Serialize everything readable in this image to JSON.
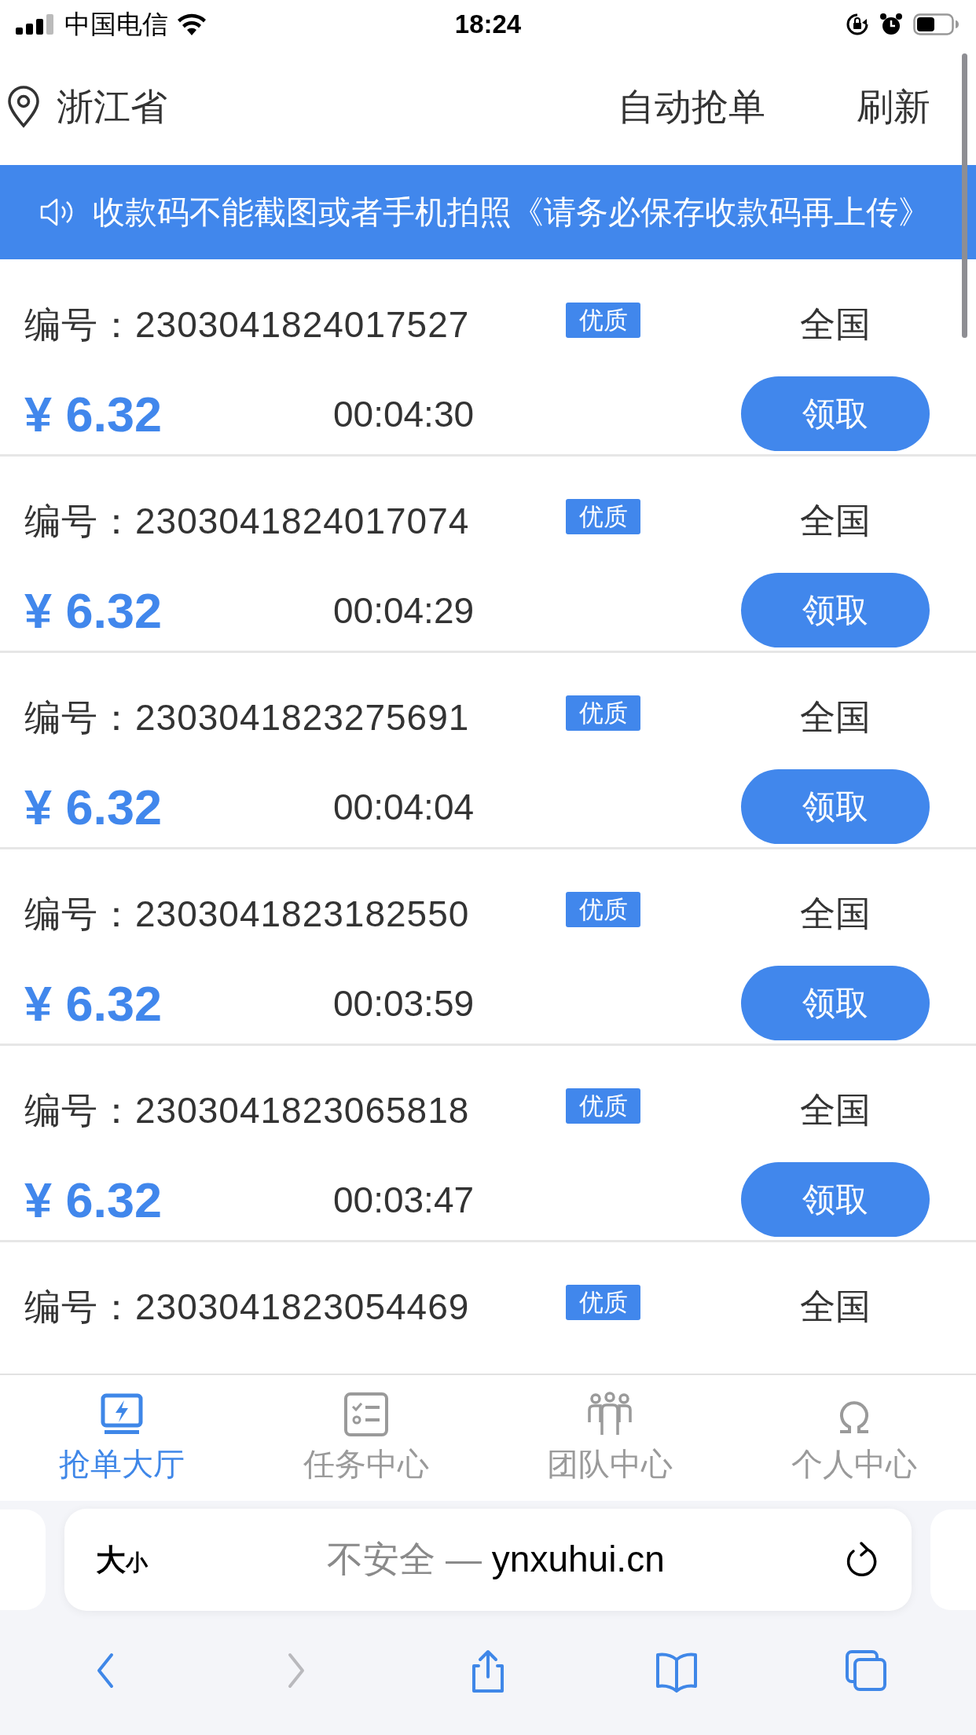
{
  "status_bar": {
    "carrier": "中国电信",
    "time": "18:24"
  },
  "header": {
    "location": "浙江省",
    "actions": [
      "自动抢单",
      "刷新"
    ]
  },
  "notice": "收款码不能截图或者手机拍照《请务必保存收款码再上传》",
  "orders": [
    {
      "id": "编号：2303041824017527",
      "badge": "优质",
      "region": "全国",
      "price": "¥ 6.32",
      "time": "00:04:30",
      "button": "领取"
    },
    {
      "id": "编号：2303041824017074",
      "badge": "优质",
      "region": "全国",
      "price": "¥ 6.32",
      "time": "00:04:29",
      "button": "领取"
    },
    {
      "id": "编号：2303041823275691",
      "badge": "优质",
      "region": "全国",
      "price": "¥ 6.32",
      "time": "00:04:04",
      "button": "领取"
    },
    {
      "id": "编号：2303041823182550",
      "badge": "优质",
      "region": "全国",
      "price": "¥ 6.32",
      "time": "00:03:59",
      "button": "领取"
    },
    {
      "id": "编号：2303041823065818",
      "badge": "优质",
      "region": "全国",
      "price": "¥ 6.32",
      "time": "00:03:47",
      "button": "领取"
    },
    {
      "id": "编号：2303041823054469",
      "badge": "优质",
      "region": "全国"
    }
  ],
  "tabs": [
    {
      "label": "抢单大厅",
      "kind": "monitor",
      "selected": true
    },
    {
      "label": "任务中心",
      "kind": "checklist",
      "selected": false
    },
    {
      "label": "团队中心",
      "kind": "team",
      "selected": false
    },
    {
      "label": "个人中心",
      "kind": "person",
      "selected": false
    }
  ],
  "browser": {
    "text_size_big": "大",
    "text_size_small": "小",
    "security": "不安全 — ",
    "url": "ynxuhui.cn"
  },
  "toolbar": [
    {
      "kind": "back",
      "disabled": false
    },
    {
      "kind": "forward",
      "disabled": true
    },
    {
      "kind": "share",
      "disabled": false
    },
    {
      "kind": "bookmarks",
      "disabled": false
    },
    {
      "kind": "tabs",
      "disabled": false
    }
  ]
}
